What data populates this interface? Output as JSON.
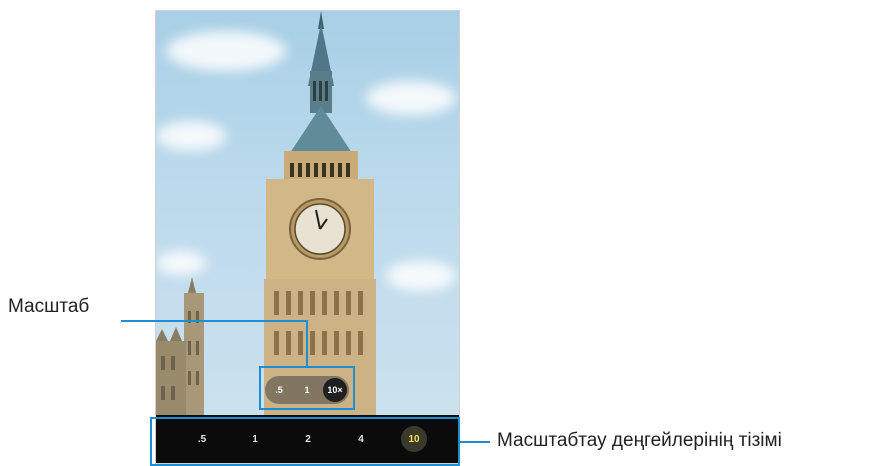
{
  "labels": {
    "zoom": "Масштаб",
    "zoom_list": "Масштабтау деңгейлерінің тізімі"
  },
  "zoom_control": {
    "buttons": [
      ".5",
      "1",
      "10×"
    ],
    "active": "10×"
  },
  "zoom_levels": {
    "items": [
      ".5",
      "1",
      "2",
      "4",
      "10"
    ],
    "active": "10"
  },
  "colors": {
    "callout_line": "#1d8fd0",
    "active_level": "#f4e04d"
  }
}
